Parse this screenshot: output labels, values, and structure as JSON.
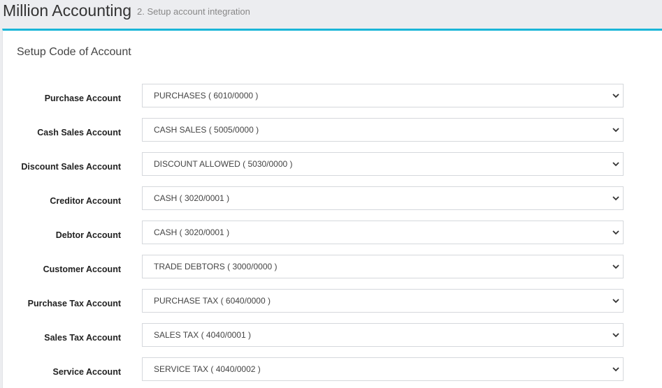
{
  "header": {
    "app_title": "Million Accounting",
    "step_subtitle": "2. Setup account integration"
  },
  "panel": {
    "title": "Setup Code of Account"
  },
  "fields": [
    {
      "label": "Purchase Account",
      "value": "PURCHASES ( 6010/0000 )"
    },
    {
      "label": "Cash Sales Account",
      "value": "CASH SALES ( 5005/0000 )"
    },
    {
      "label": "Discount Sales Account",
      "value": "DISCOUNT ALLOWED ( 5030/0000 )"
    },
    {
      "label": "Creditor Account",
      "value": "CASH ( 3020/0001 )"
    },
    {
      "label": "Debtor Account",
      "value": "CASH ( 3020/0001 )"
    },
    {
      "label": "Customer Account",
      "value": "TRADE DEBTORS ( 3000/0000 )"
    },
    {
      "label": "Purchase Tax Account",
      "value": "PURCHASE TAX ( 6040/0000 )"
    },
    {
      "label": "Sales Tax Account",
      "value": "SALES TAX ( 4040/0001 )"
    },
    {
      "label": "Service Account",
      "value": "SERVICE TAX ( 4040/0002 )"
    }
  ],
  "colors": {
    "accent": "#1ab6d8",
    "header_bg": "#ecedf0",
    "panel_bg": "#ffffff"
  },
  "icons": {
    "dropdown": "chevron-down-icon"
  }
}
